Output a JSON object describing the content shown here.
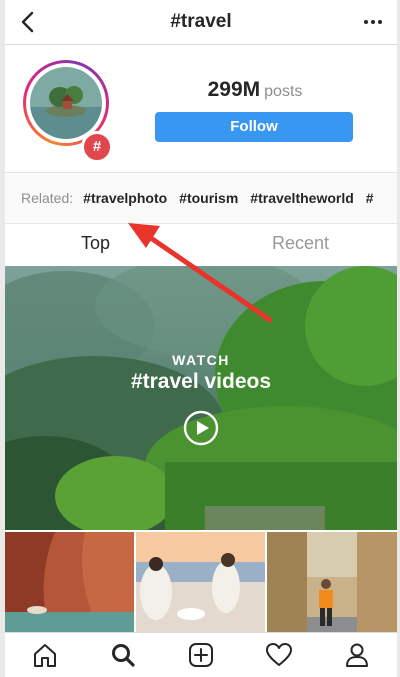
{
  "header": {
    "title": "#travel"
  },
  "stats": {
    "posts_count": "299M",
    "posts_label": "posts"
  },
  "actions": {
    "follow_label": "Follow"
  },
  "related": {
    "label": "Related:",
    "tags": [
      "#travelphoto",
      "#tourism",
      "#traveltheworld",
      "#"
    ]
  },
  "tabs": [
    {
      "label": "Top",
      "active": true
    },
    {
      "label": "Recent",
      "active": false
    }
  ],
  "feature": {
    "watch_label": "WATCH",
    "title": "#travel videos"
  },
  "badge": {
    "symbol": "#"
  },
  "icons": {
    "header": [
      "back-icon",
      "more-icon"
    ],
    "feature": "play-icon",
    "bottom_nav": [
      "home-icon",
      "search-icon",
      "add-post-icon",
      "activity-heart-icon",
      "profile-icon"
    ]
  },
  "colors": {
    "follow_button": "#3897f0",
    "badge": "#e0474c",
    "annotation_arrow": "#e8342a"
  }
}
